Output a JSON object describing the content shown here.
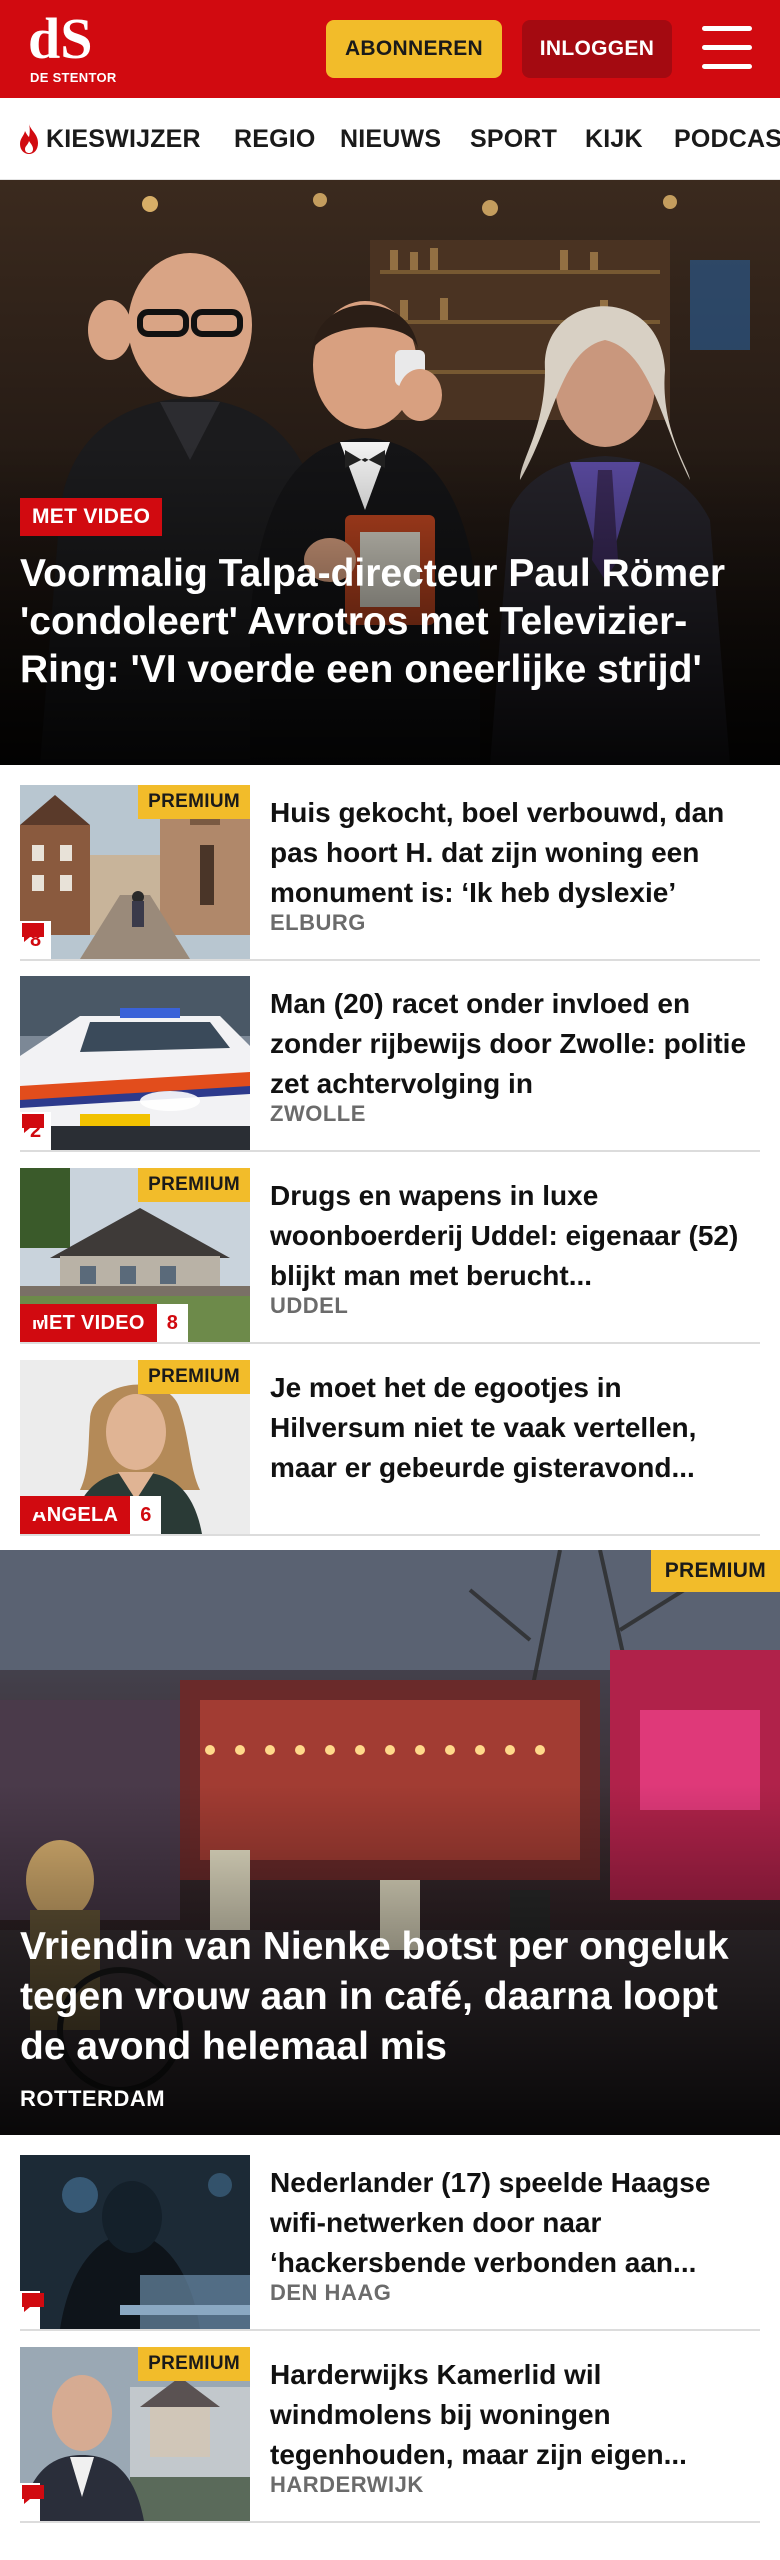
{
  "header": {
    "logo_text": "dS",
    "logo_subtitle": "DE STENTOR",
    "subscribe_label": "ABONNEREN",
    "login_label": "INLOGGEN",
    "brand_color": "#d10a10",
    "accent_color": "#f2bc2a",
    "menu_icon": "hamburger-menu-icon"
  },
  "nav": {
    "items": [
      {
        "label": "KIESWIJZER",
        "icon": "flame-icon"
      },
      {
        "label": "REGIO"
      },
      {
        "label": "NIEUWS"
      },
      {
        "label": "SPORT"
      },
      {
        "label": "KIJK"
      },
      {
        "label": "PODCAS"
      }
    ]
  },
  "hero": {
    "label": "MET VIDEO",
    "title": "Voormalig Talpa-directeur Paul Römer 'condoleert' Avrotros met Televizier-Ring: 'VI voerde een oneerlijke strijd'"
  },
  "articles": [
    {
      "premium": "PREMIUM",
      "title": "Huis gekocht, boel verbouwd, dan pas hoort H. dat zijn woning een monument is: ‘Ik heb dyslexie’",
      "location": "ELBURG",
      "comments": "8"
    },
    {
      "title": "Man (20) racet onder invloed en zonder rijbewijs door Zwolle: politie zet achtervolging in",
      "location": "ZWOLLE",
      "comments": "2"
    },
    {
      "premium": "PREMIUM",
      "label": "MET VIDEO",
      "title": "Drugs en wapens in luxe woonboerderij Uddel: eigenaar (52) blijkt man met berucht...",
      "location": "UDDEL",
      "comments": "8"
    },
    {
      "premium": "PREMIUM",
      "label": "ANGELA",
      "title": "Je moet het de egootjes in Hilversum niet te vaak vertellen, maar er gebeurde gisteravond...",
      "comments": "6"
    }
  ],
  "feature": {
    "premium": "PREMIUM",
    "title": "Vriendin van Nienke botst per ongeluk tegen vrouw aan in café, daarna loopt de avond helemaal mis",
    "location": "ROTTERDAM"
  },
  "articles2": [
    {
      "title": "Nederlander (17) speelde Haagse wifi-netwerken door naar ‘hackersbende verbonden aan...",
      "location": "DEN HAAG"
    },
    {
      "premium": "PREMIUM",
      "title": "Harderwijks Kamerlid wil windmolens bij woningen tegenhouden, maar zijn eigen...",
      "location": "HARDERWIJK"
    }
  ]
}
